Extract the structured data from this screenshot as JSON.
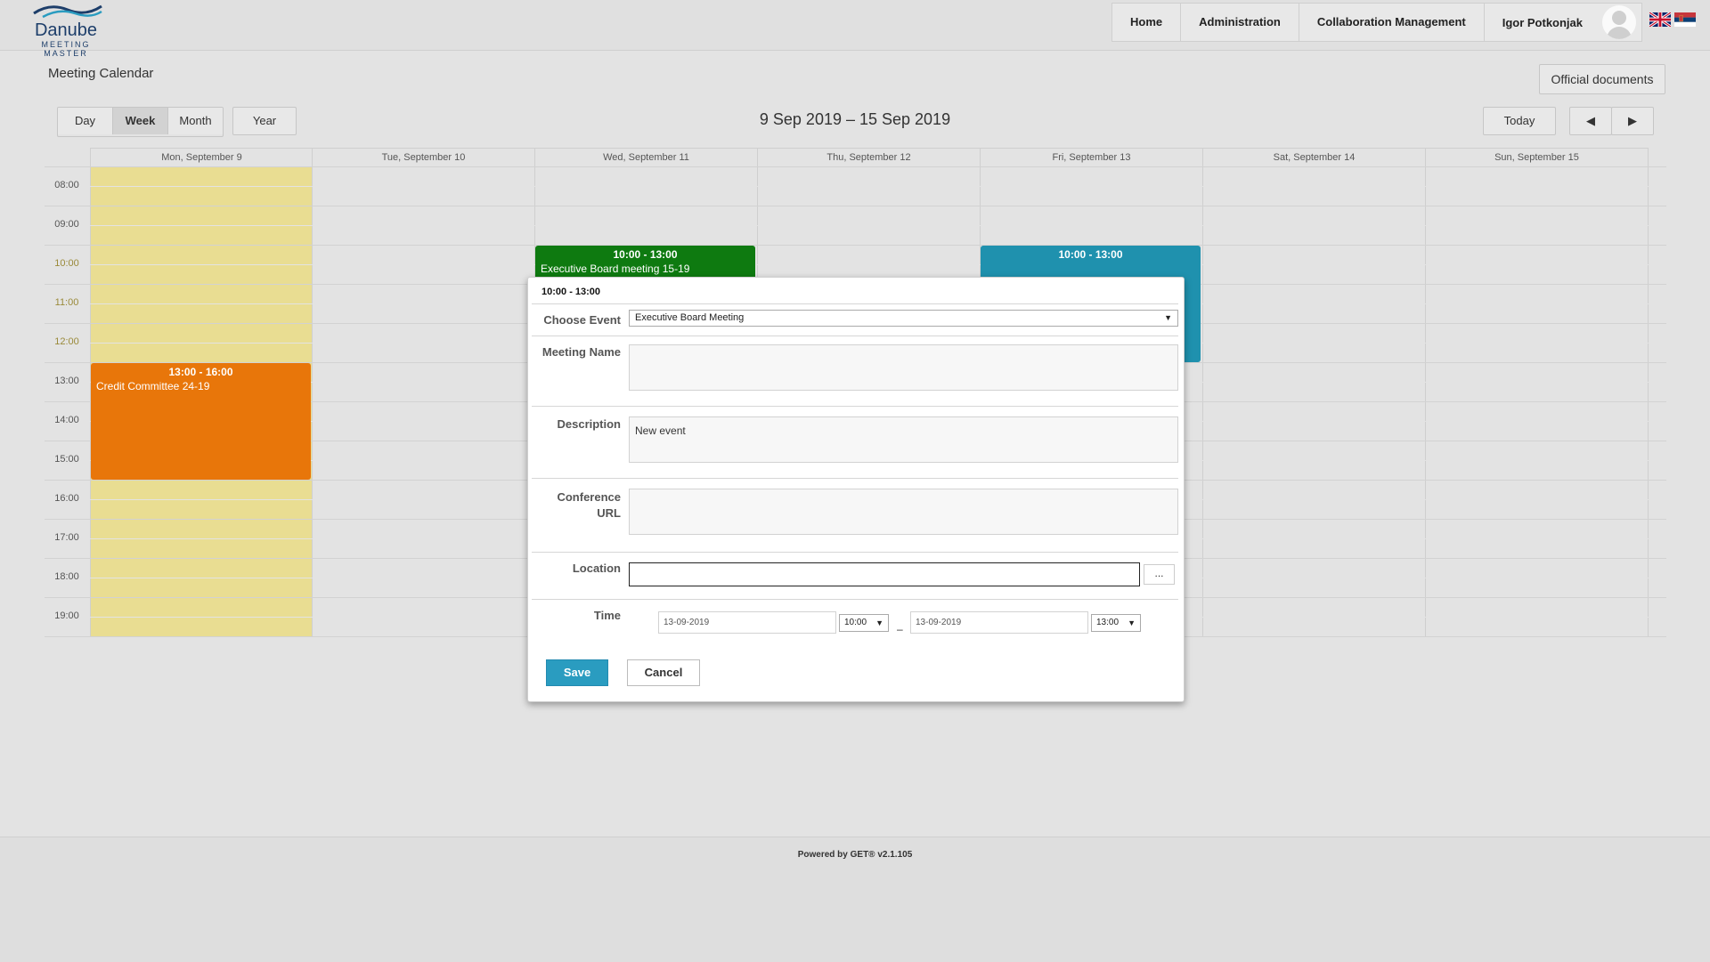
{
  "logo": {
    "title": "Danube",
    "subtitle": "MEETING MASTER"
  },
  "nav": {
    "home": "Home",
    "administration": "Administration",
    "collaboration": "Collaboration Management",
    "user": "Igor Potkonjak"
  },
  "languages": [
    "uk-flag-icon",
    "serbian-flag-icon"
  ],
  "page": {
    "title": "Meeting Calendar",
    "official_documents": "Official documents"
  },
  "toolbar": {
    "day": "Day",
    "week": "Week",
    "month": "Month",
    "year": "Year",
    "active_view": "Week",
    "today": "Today",
    "prev_icon": "◀",
    "next_icon": "▶"
  },
  "calendar": {
    "range": "9 Sep 2019 – 15 Sep 2019",
    "days": [
      "Mon, September 9",
      "Tue, September 10",
      "Wed, September 11",
      "Thu, September 12",
      "Fri, September 13",
      "Sat, September 14",
      "Sun, September 15"
    ],
    "hours": [
      "08:00",
      "09:00",
      "10:00",
      "11:00",
      "12:00",
      "13:00",
      "14:00",
      "15:00",
      "16:00",
      "17:00",
      "18:00",
      "19:00"
    ],
    "today_color": "#e9dd92",
    "events": [
      {
        "time": "10:00 - 13:00",
        "title": "Executive Board meeting 15-19",
        "day": "Wed, September 11",
        "color": "#0e7a10"
      },
      {
        "time": "10:00 - 13:00",
        "title": "",
        "day": "Fri, September 13",
        "color": "#1f91ae"
      },
      {
        "time": "13:00 - 16:00",
        "title": "Credit Committee 24-19",
        "day": "Mon, September 9",
        "color": "#e8760a"
      }
    ]
  },
  "modal": {
    "title": "10:00 - 13:00",
    "choose_event_label": "Choose Event",
    "choose_event_value": "Executive Board Meeting",
    "meeting_name_label": "Meeting Name",
    "meeting_name_value": "",
    "description_label": "Description",
    "description_value": "New event",
    "conference_url_label_1": "Conference",
    "conference_url_label_2": "URL",
    "conference_url_value": "",
    "location_label": "Location",
    "location_value": "",
    "location_button": "...",
    "time_label": "Time",
    "start_date": "13-09-2019",
    "start_time": "10:00",
    "end_date": "13-09-2019",
    "end_time": "13:00",
    "range_separator": "–",
    "save": "Save",
    "cancel": "Cancel",
    "save_color": "#2a9cc0"
  },
  "footer": {
    "powered": "Powered by GET® v2.1.105"
  }
}
